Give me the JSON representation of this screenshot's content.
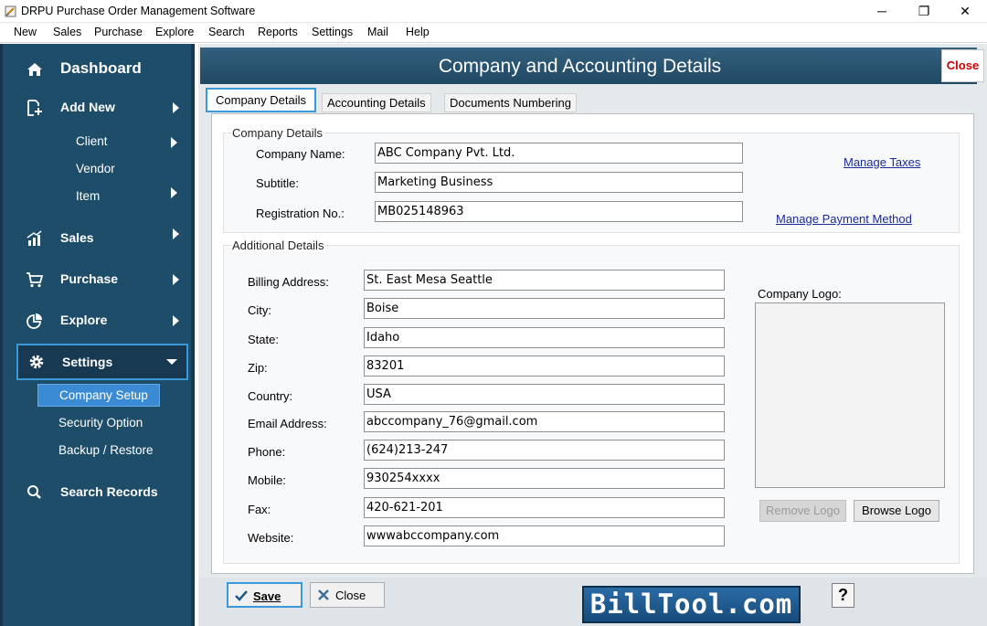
{
  "window": {
    "title": "DRPU Purchase Order Management Software",
    "minimize": "─",
    "maximize": "❐",
    "close": "✕"
  },
  "menu": [
    "New",
    "Sales",
    "Purchase",
    "Explore",
    "Search",
    "Reports",
    "Settings",
    "Mail",
    "Help"
  ],
  "sidebar": {
    "dashboard": "Dashboard",
    "add_new": "Add New",
    "add_new_sub": [
      "Client",
      "Vendor",
      "Item"
    ],
    "sales": "Sales",
    "purchase": "Purchase",
    "explore": "Explore",
    "settings": "Settings",
    "settings_sub": [
      "Company Setup",
      "Security Option",
      "Backup / Restore"
    ],
    "search_records": "Search Records"
  },
  "header": {
    "title": "Company and Accounting Details",
    "close": "Close"
  },
  "tabs": [
    "Company Details",
    "Accounting Details",
    "Documents Numbering"
  ],
  "company_details": {
    "legend": "Company Details",
    "company_name_label": "Company Name:",
    "company_name": "ABC Company Pvt. Ltd.",
    "subtitle_label": "Subtitle:",
    "subtitle": "Marketing Business",
    "registration_label": "Registration No.:",
    "registration": "MB025148963",
    "manage_taxes": "Manage Taxes",
    "manage_payment": "Manage Payment Method"
  },
  "additional_details": {
    "legend": "Additional Details",
    "billing_address_label": "Billing Address:",
    "billing_address": "St. East Mesa Seattle",
    "city_label": "City:",
    "city": "Boise",
    "state_label": "State:",
    "state": "Idaho",
    "zip_label": "Zip:",
    "zip": "83201",
    "country_label": "Country:",
    "country": "USA",
    "email_label": "Email Address:",
    "email": "abccompany_76@gmail.com",
    "phone_label": "Phone:",
    "phone": "(624)213-247",
    "mobile_label": "Mobile:",
    "mobile": "930254xxxx",
    "fax_label": "Fax:",
    "fax": "420-621-201",
    "website_label": "Website:",
    "website": "wwwabccompany.com",
    "company_logo_label": "Company Logo:",
    "remove_logo": "Remove Logo",
    "browse_logo": "Browse Logo"
  },
  "footer": {
    "save": "Save",
    "close": "Close",
    "brand": "BillTool.com",
    "help": "?"
  },
  "colors": {
    "sidebar_bg": "#1e4d6a",
    "header_bg": "#2b5773",
    "selection_border": "#3a9ad9",
    "active_sub_bg": "#3a8bd3",
    "close_text": "#d00000",
    "link": "#1a2a9a"
  }
}
